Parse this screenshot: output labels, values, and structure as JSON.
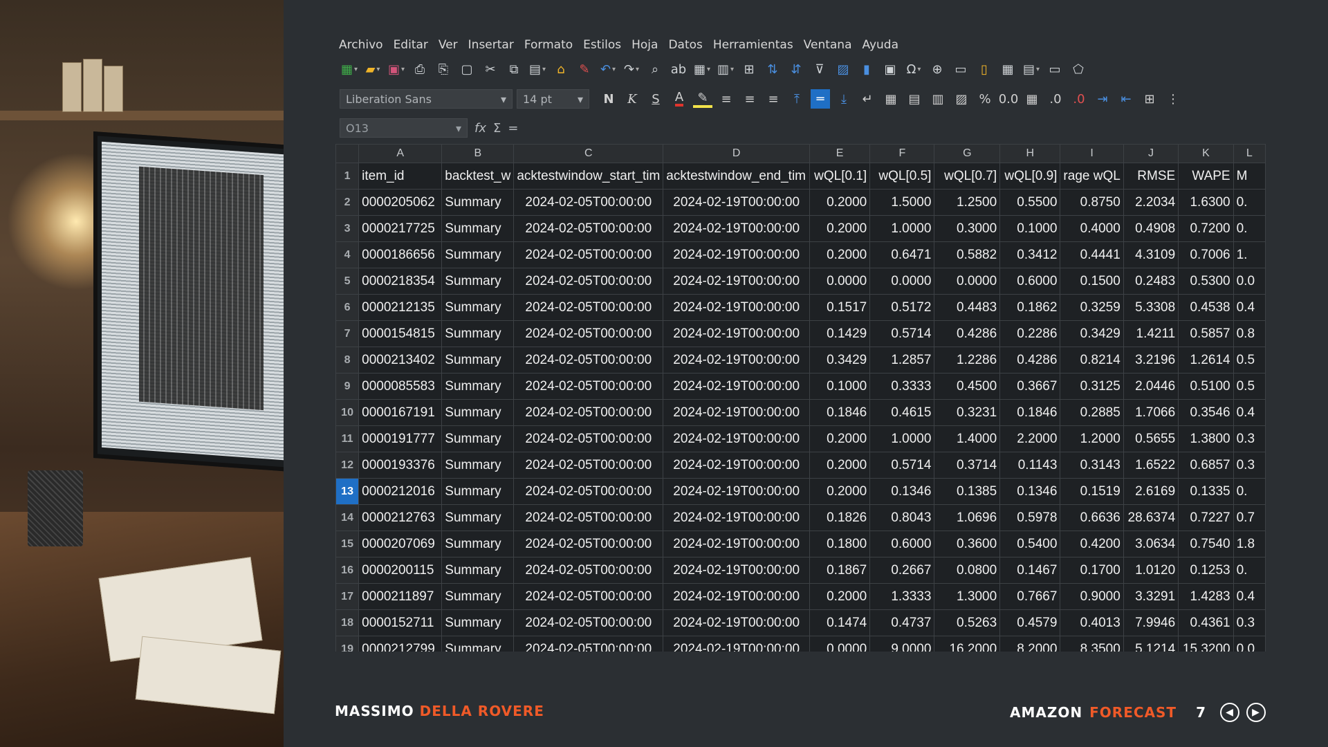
{
  "menu": [
    "Archivo",
    "Editar",
    "Ver",
    "Insertar",
    "Formato",
    "Estilos",
    "Hoja",
    "Datos",
    "Herramientas",
    "Ventana",
    "Ayuda"
  ],
  "format": {
    "font_name": "Liberation Sans",
    "font_size": "14 pt",
    "bold": "N",
    "italic": "K",
    "underline": "S",
    "font_color_letter": "A",
    "percent": "%",
    "font_color": "#e0342c",
    "highlight_color": "#f2e24a"
  },
  "formula": {
    "cell_ref": "O13",
    "fx": "fx",
    "sigma": "Σ",
    "equals": "="
  },
  "sheet": {
    "columns": [
      "A",
      "B",
      "C",
      "D",
      "E",
      "F",
      "G",
      "H",
      "I",
      "J",
      "K",
      "L"
    ],
    "header": [
      "item_id",
      "backtest_w",
      "acktestwindow_start_tim",
      "acktestwindow_end_tim",
      "wQL[0.1]",
      "wQL[0.5]",
      "wQL[0.7]",
      "wQL[0.9]",
      "rage wQL",
      "RMSE",
      "WAPE",
      "M"
    ],
    "selected_row": "13",
    "rows": [
      {
        "n": "2",
        "c": [
          "0000205062",
          "Summary",
          "2024-02-05T00:00:00",
          "2024-02-19T00:00:00",
          "0.2000",
          "1.5000",
          "1.2500",
          "0.5500",
          "0.8750",
          "2.2034",
          "1.6300",
          "0."
        ]
      },
      {
        "n": "3",
        "c": [
          "0000217725",
          "Summary",
          "2024-02-05T00:00:00",
          "2024-02-19T00:00:00",
          "0.2000",
          "1.0000",
          "0.3000",
          "0.1000",
          "0.4000",
          "0.4908",
          "0.7200",
          "0."
        ]
      },
      {
        "n": "4",
        "c": [
          "0000186656",
          "Summary",
          "2024-02-05T00:00:00",
          "2024-02-19T00:00:00",
          "0.2000",
          "0.6471",
          "0.5882",
          "0.3412",
          "0.4441",
          "4.3109",
          "0.7006",
          "1."
        ]
      },
      {
        "n": "5",
        "c": [
          "0000218354",
          "Summary",
          "2024-02-05T00:00:00",
          "2024-02-19T00:00:00",
          "0.0000",
          "0.0000",
          "0.0000",
          "0.6000",
          "0.1500",
          "0.2483",
          "0.5300",
          "0.0"
        ]
      },
      {
        "n": "6",
        "c": [
          "0000212135",
          "Summary",
          "2024-02-05T00:00:00",
          "2024-02-19T00:00:00",
          "0.1517",
          "0.5172",
          "0.4483",
          "0.1862",
          "0.3259",
          "5.3308",
          "0.4538",
          "0.4"
        ]
      },
      {
        "n": "7",
        "c": [
          "0000154815",
          "Summary",
          "2024-02-05T00:00:00",
          "2024-02-19T00:00:00",
          "0.1429",
          "0.5714",
          "0.4286",
          "0.2286",
          "0.3429",
          "1.4211",
          "0.5857",
          "0.8"
        ]
      },
      {
        "n": "8",
        "c": [
          "0000213402",
          "Summary",
          "2024-02-05T00:00:00",
          "2024-02-19T00:00:00",
          "0.3429",
          "1.2857",
          "1.2286",
          "0.4286",
          "0.8214",
          "3.2196",
          "1.2614",
          "0.5"
        ]
      },
      {
        "n": "9",
        "c": [
          "0000085583",
          "Summary",
          "2024-02-05T00:00:00",
          "2024-02-19T00:00:00",
          "0.1000",
          "0.3333",
          "0.4500",
          "0.3667",
          "0.3125",
          "2.0446",
          "0.5100",
          "0.5"
        ]
      },
      {
        "n": "10",
        "c": [
          "0000167191",
          "Summary",
          "2024-02-05T00:00:00",
          "2024-02-19T00:00:00",
          "0.1846",
          "0.4615",
          "0.3231",
          "0.1846",
          "0.2885",
          "1.7066",
          "0.3546",
          "0.4"
        ]
      },
      {
        "n": "11",
        "c": [
          "0000191777",
          "Summary",
          "2024-02-05T00:00:00",
          "2024-02-19T00:00:00",
          "0.2000",
          "1.0000",
          "1.4000",
          "2.2000",
          "1.2000",
          "0.5655",
          "1.3800",
          "0.3"
        ]
      },
      {
        "n": "12",
        "c": [
          "0000193376",
          "Summary",
          "2024-02-05T00:00:00",
          "2024-02-19T00:00:00",
          "0.2000",
          "0.5714",
          "0.3714",
          "0.1143",
          "0.3143",
          "1.6522",
          "0.6857",
          "0.3"
        ]
      },
      {
        "n": "13",
        "c": [
          "0000212016",
          "Summary",
          "2024-02-05T00:00:00",
          "2024-02-19T00:00:00",
          "0.2000",
          "0.1346",
          "0.1385",
          "0.1346",
          "0.1519",
          "2.6169",
          "0.1335",
          "0."
        ]
      },
      {
        "n": "14",
        "c": [
          "0000212763",
          "Summary",
          "2024-02-05T00:00:00",
          "2024-02-19T00:00:00",
          "0.1826",
          "0.8043",
          "1.0696",
          "0.5978",
          "0.6636",
          "28.6374",
          "0.7227",
          "0.7"
        ]
      },
      {
        "n": "15",
        "c": [
          "0000207069",
          "Summary",
          "2024-02-05T00:00:00",
          "2024-02-19T00:00:00",
          "0.1800",
          "0.6000",
          "0.3600",
          "0.5400",
          "0.4200",
          "3.0634",
          "0.7540",
          "1.8"
        ]
      },
      {
        "n": "16",
        "c": [
          "0000200115",
          "Summary",
          "2024-02-05T00:00:00",
          "2024-02-19T00:00:00",
          "0.1867",
          "0.2667",
          "0.0800",
          "0.1467",
          "0.1700",
          "1.0120",
          "0.1253",
          "0."
        ]
      },
      {
        "n": "17",
        "c": [
          "0000211897",
          "Summary",
          "2024-02-05T00:00:00",
          "2024-02-19T00:00:00",
          "0.2000",
          "1.3333",
          "1.3000",
          "0.7667",
          "0.9000",
          "3.3291",
          "1.4283",
          "0.4"
        ]
      },
      {
        "n": "18",
        "c": [
          "0000152711",
          "Summary",
          "2024-02-05T00:00:00",
          "2024-02-19T00:00:00",
          "0.1474",
          "0.4737",
          "0.5263",
          "0.4579",
          "0.4013",
          "7.9946",
          "0.4361",
          "0.3"
        ]
      },
      {
        "n": "19",
        "c": [
          "0000212799",
          "Summary",
          "2024-02-05T00:00:00",
          "2024-02-19T00:00:00",
          "0.0000",
          "9.0000",
          "16.2000",
          "8.2000",
          "8.3500",
          "5.1214",
          "15.3200",
          "0.0"
        ]
      }
    ]
  },
  "footer": {
    "author_first": "MASSIMO",
    "author_last": "DELLA ROVERE",
    "topic_first": "AMAZON",
    "topic_last": "FORECAST",
    "page": "7"
  },
  "colors": {
    "accent": "#f05a28",
    "selection": "#1f6fc5",
    "background": "#2b2f33"
  }
}
